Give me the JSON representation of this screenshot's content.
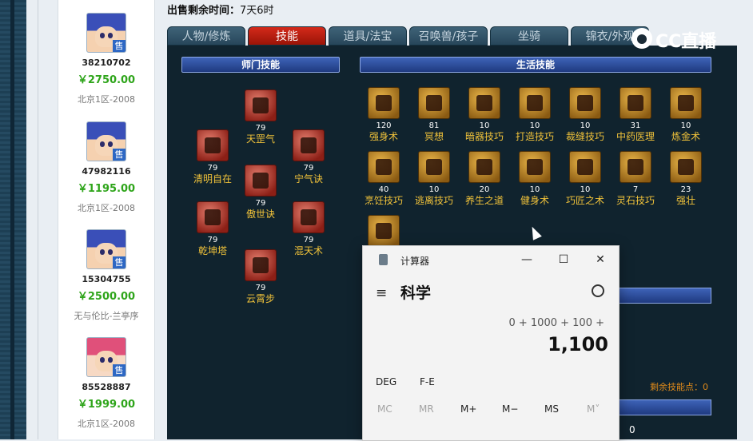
{
  "time": {
    "label": "出售剩余时间：",
    "value": "7天6时"
  },
  "sellers": [
    {
      "id": "38210702",
      "price": "￥2750.00",
      "server": "北京1区-2008",
      "badge": "售",
      "hair": "blue"
    },
    {
      "id": "47982116",
      "price": "￥1195.00",
      "server": "北京1区-2008",
      "badge": "售",
      "hair": "blue"
    },
    {
      "id": "15304755",
      "price": "￥2500.00",
      "server": "无与伦比-兰亭序",
      "badge": "售",
      "hair": "blue"
    },
    {
      "id": "85528887",
      "price": "￥1999.00",
      "server": "北京1区-2008",
      "badge": "售",
      "hair": "pink"
    }
  ],
  "tabs": [
    "人物/修炼",
    "技能",
    "道具/法宝",
    "召唤兽/孩子",
    "坐骑",
    "锦衣/外观"
  ],
  "active_tab": 1,
  "sections": {
    "school": "师门技能",
    "life": "生活技能"
  },
  "school_skills": [
    {
      "level": "79",
      "name": "天罡气"
    },
    {
      "level": "79",
      "name": "清明自在"
    },
    {
      "level": "79",
      "name": "宁气诀"
    },
    {
      "level": "79",
      "name": "傲世诀"
    },
    {
      "level": "79",
      "name": "乾坤塔"
    },
    {
      "level": "79",
      "name": "混天术"
    },
    {
      "level": "79",
      "name": "云霄步"
    }
  ],
  "life_skills": [
    {
      "level": "120",
      "name": "强身术"
    },
    {
      "level": "81",
      "name": "冥想"
    },
    {
      "level": "10",
      "name": "暗器技巧"
    },
    {
      "level": "10",
      "name": "打造技巧"
    },
    {
      "level": "10",
      "name": "裁缝技巧"
    },
    {
      "level": "31",
      "name": "中药医理"
    },
    {
      "level": "10",
      "name": "炼金术"
    },
    {
      "level": "40",
      "name": "烹饪技巧"
    },
    {
      "level": "10",
      "name": "逃离技巧"
    },
    {
      "level": "20",
      "name": "养生之道"
    },
    {
      "level": "10",
      "name": "健身术"
    },
    {
      "level": "10",
      "name": "巧匠之术"
    },
    {
      "level": "7",
      "name": "灵石技巧"
    },
    {
      "level": "23",
      "name": "强壮"
    },
    {
      "level": "",
      "name": ""
    }
  ],
  "remaining_points": {
    "label": "剩余技能点：",
    "value": "0"
  },
  "bottom_value": "0",
  "watermark": "CC直播",
  "calculator": {
    "title": "计算器",
    "mode": "科学",
    "expression": "0 + 1000 + 100 +",
    "result": "1,100",
    "options": [
      "DEG",
      "F-E"
    ],
    "memory": [
      "MC",
      "MR",
      "M+",
      "M−",
      "MS",
      "M˅"
    ],
    "window_buttons": [
      "—",
      "☐",
      "✕"
    ],
    "menu_icon": "≡"
  },
  "colors": {
    "skill_name": "#f0c23a",
    "price": "#2fa51b",
    "active_tab": "#c3210f"
  }
}
